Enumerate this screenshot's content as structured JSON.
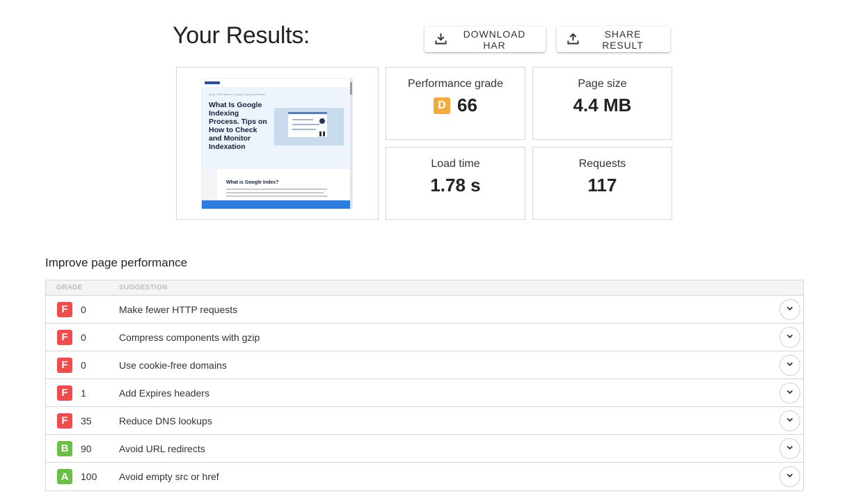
{
  "header": {
    "title": "Your Results:"
  },
  "actions": {
    "download_label": "DOWNLOAD HAR",
    "share_label": "SHARE RESULT"
  },
  "preview": {
    "crumb": "Blog  ›  SEO Basics  ›  Google Indexing Process",
    "headline": "What Is Google Indexing Process. Tips on How to Check and Monitor Indexation",
    "section_heading": "What is Google Index?"
  },
  "metrics": {
    "performance": {
      "label": "Performance grade",
      "grade": "D",
      "score": "66",
      "grade_color": "#f0ad3e"
    },
    "page_size": {
      "label": "Page size",
      "value": "4.4 MB"
    },
    "load_time": {
      "label": "Load time",
      "value": "1.78 s"
    },
    "requests": {
      "label": "Requests",
      "value": "117"
    }
  },
  "improve": {
    "title": "Improve page performance",
    "columns": {
      "grade": "GRADE",
      "suggestion": "SUGGESTION"
    },
    "rows": [
      {
        "grade": "F",
        "score": "0",
        "suggestion": "Make fewer HTTP requests",
        "color": "#f24b4b"
      },
      {
        "grade": "F",
        "score": "0",
        "suggestion": "Compress components with gzip",
        "color": "#f24b4b"
      },
      {
        "grade": "F",
        "score": "0",
        "suggestion": "Use cookie-free domains",
        "color": "#f24b4b"
      },
      {
        "grade": "F",
        "score": "1",
        "suggestion": "Add Expires headers",
        "color": "#f24b4b"
      },
      {
        "grade": "F",
        "score": "35",
        "suggestion": "Reduce DNS lookups",
        "color": "#f24b4b"
      },
      {
        "grade": "B",
        "score": "90",
        "suggestion": "Avoid URL redirects",
        "color": "#6abf45"
      },
      {
        "grade": "A",
        "score": "100",
        "suggestion": "Avoid empty src or href",
        "color": "#6abf45"
      }
    ]
  },
  "icons": {
    "download": "download-icon",
    "share": "share-icon",
    "expand": "chevron-down-icon"
  }
}
